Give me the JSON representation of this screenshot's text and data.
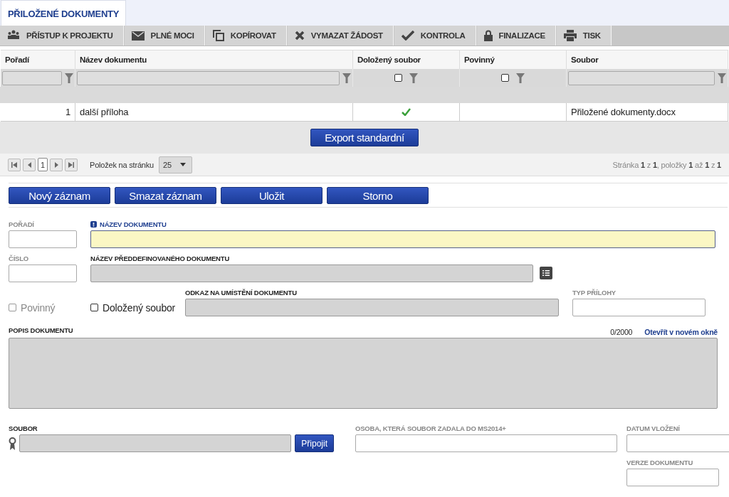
{
  "tabs": [
    {
      "label": "PŘILOŽENÉ DOKUMENTY",
      "selected": true
    }
  ],
  "toolbar": [
    {
      "label": "PŘÍSTUP K PROJEKTU",
      "kind": "people"
    },
    {
      "label": "PLNÉ MOCI",
      "kind": "mail"
    },
    {
      "label": "KOPÍROVAT",
      "kind": "copy"
    },
    {
      "label": "VYMAZAT ŽÁDOST",
      "kind": "cross"
    },
    {
      "label": "KONTROLA",
      "kind": "check"
    },
    {
      "label": "FINALIZACE",
      "kind": "lock"
    },
    {
      "label": "TISK",
      "kind": "printer"
    }
  ],
  "table": {
    "columns": [
      {
        "label": "Pořadí",
        "filter": {
          "kind": "text"
        }
      },
      {
        "label": "Název dokumentu",
        "filter": {
          "kind": "text"
        }
      },
      {
        "label": "Doložený soubor",
        "filter": {
          "kind": "checkbox",
          "checked": false
        }
      },
      {
        "label": "Povinný",
        "filter": {
          "kind": "checkbox",
          "checked": false
        }
      },
      {
        "label": "Soubor",
        "filter": {
          "kind": "text"
        }
      }
    ],
    "rows": [
      {
        "order": "1",
        "name": "další příloha",
        "attached": true,
        "mandatory": false,
        "file": "Přiložené dokumenty.docx"
      }
    ]
  },
  "export_button": "Export standardní",
  "pager": {
    "page": "1",
    "per_page_label": "Položek na stránku",
    "per_page": "25",
    "summary": "Stránka **1** z **1**, položky **1** až **1** z **1**"
  },
  "form": {
    "buttons": [
      "Nový záznam",
      "Smazat záznam",
      "Uložit",
      "Storno"
    ],
    "order": {
      "label": "POŘADÍ",
      "kind": "editable"
    },
    "name": {
      "label": "NÁZEV DOKUMENTU",
      "kind": "required"
    },
    "number": {
      "label": "ČÍSLO",
      "kind": "editable"
    },
    "predefined": {
      "label": "NÁZEV PŘEDDEFINOVANÉHO DOKUMENTU",
      "kind": "readonly"
    },
    "mandatory": {
      "label": "Povinný",
      "checked": false,
      "disabled": true
    },
    "attached": {
      "label": "Doložený soubor",
      "checked": false,
      "disabled": false
    },
    "location": {
      "label": "ODKAZ NA UMÍSTĚNÍ DOKUMENTU",
      "kind": "readonly"
    },
    "attachment_type": {
      "label": "TYP PŘÍLOHY",
      "kind": "editable"
    },
    "description": {
      "label": "POPIS DOKUMENTU",
      "kind": "readonly",
      "counter": "0/2000",
      "link": "Otevřít v novém okně"
    },
    "file": {
      "label": "SOUBOR",
      "kind": "readonly",
      "button": "Připojit"
    },
    "uploaded_by": {
      "label": "OSOBA, KTERÁ SOUBOR ZADALA DO MS2014+",
      "kind": "editable"
    },
    "upload_date": {
      "label": "DATUM VLOŽENÍ",
      "kind": "editable"
    },
    "version": {
      "label": "VERZE DOKUMENTU",
      "kind": "editable"
    }
  }
}
